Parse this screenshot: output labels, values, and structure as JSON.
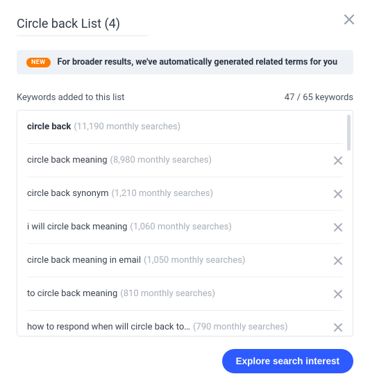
{
  "title": "Circle back List (4)",
  "banner": {
    "badge": "NEW",
    "text": "For broader results, we've automatically generated related terms for you"
  },
  "subhead": {
    "left": "Keywords added to this list",
    "right": "47 / 65 keywords"
  },
  "rows": [
    {
      "term": "circle back",
      "sub": "(11,190 monthly searches)",
      "bold": true,
      "removable": false
    },
    {
      "term": "circle back meaning",
      "sub": "(8,980 monthly searches)",
      "bold": false,
      "removable": true
    },
    {
      "term": "circle back synonym",
      "sub": "(1,210 monthly searches)",
      "bold": false,
      "removable": true
    },
    {
      "term": "i will circle back meaning",
      "sub": "(1,060 monthly searches)",
      "bold": false,
      "removable": true
    },
    {
      "term": "circle back meaning in email",
      "sub": "(1,050 monthly searches)",
      "bold": false,
      "removable": true
    },
    {
      "term": "to circle back meaning",
      "sub": "(810 monthly searches)",
      "bold": false,
      "removable": true
    },
    {
      "term": "how to respond when will circle back to…",
      "sub": "(790 monthly searches)",
      "bold": false,
      "removable": true
    }
  ],
  "cta": "Explore search interest"
}
